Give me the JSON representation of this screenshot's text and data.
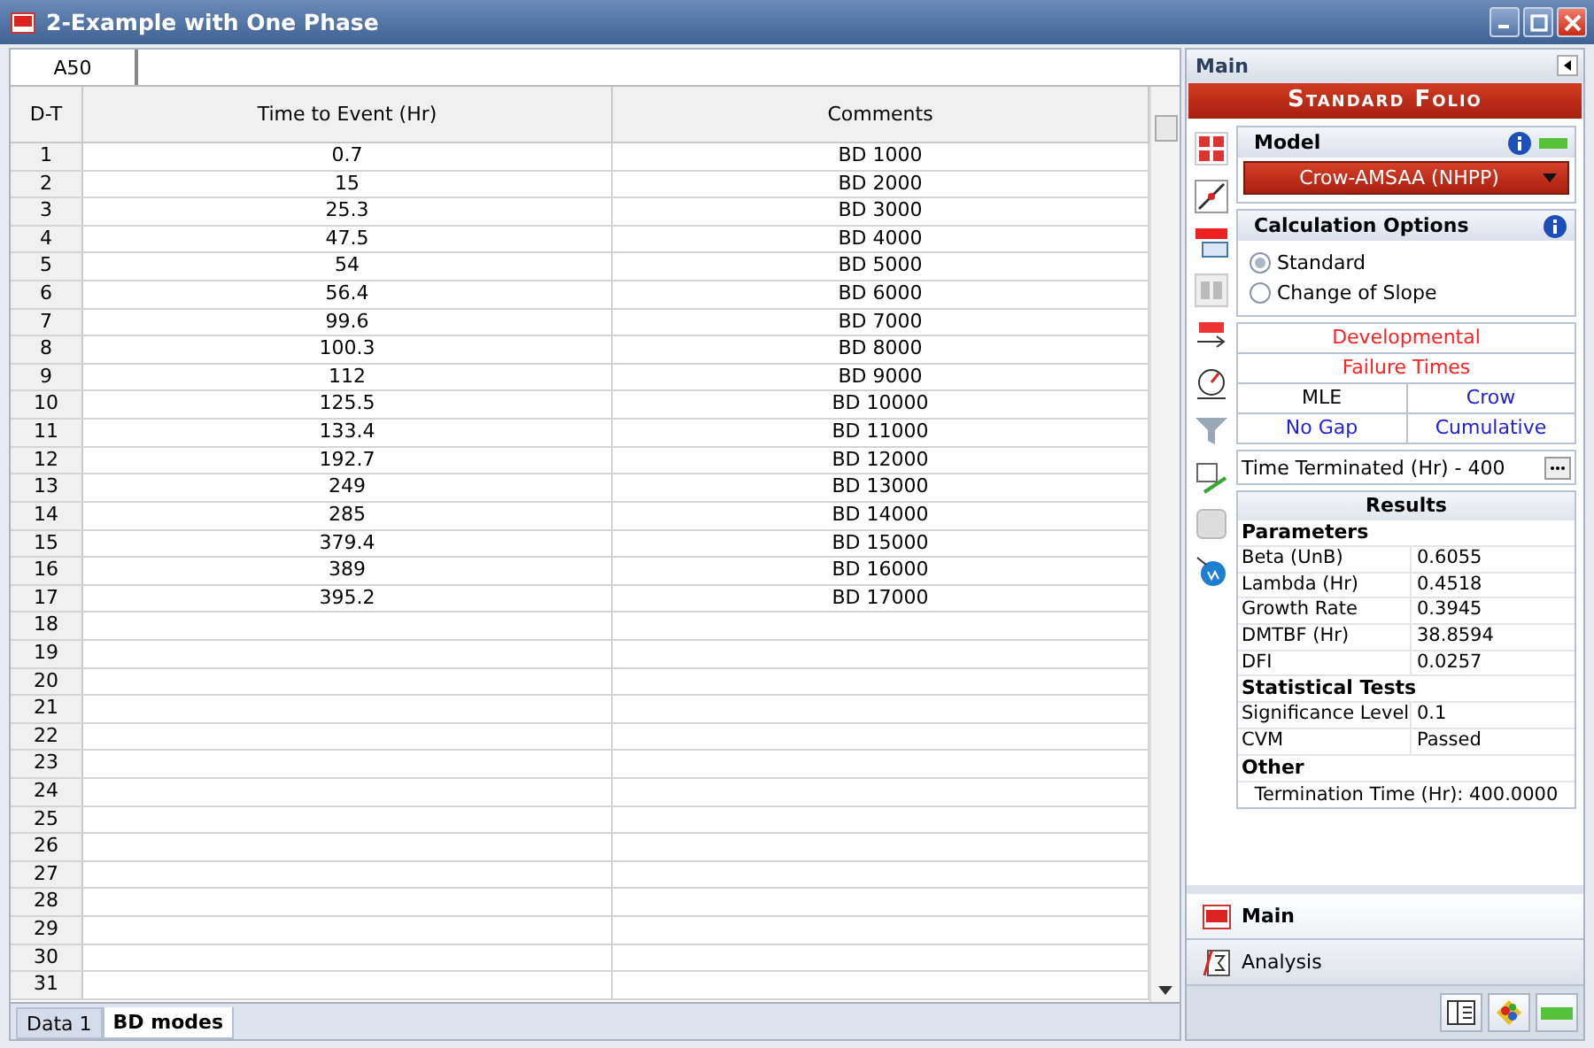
{
  "window": {
    "title": "2-Example with One Phase"
  },
  "cell_reference": "A50",
  "table": {
    "columns": [
      "D-T",
      "Time to Event (Hr)",
      "Comments"
    ],
    "rows": [
      {
        "dt": "1",
        "time": "0.7",
        "comments": "BD 1000"
      },
      {
        "dt": "2",
        "time": "15",
        "comments": "BD 2000"
      },
      {
        "dt": "3",
        "time": "25.3",
        "comments": "BD 3000"
      },
      {
        "dt": "4",
        "time": "47.5",
        "comments": "BD 4000"
      },
      {
        "dt": "5",
        "time": "54",
        "comments": "BD 5000"
      },
      {
        "dt": "6",
        "time": "56.4",
        "comments": "BD 6000"
      },
      {
        "dt": "7",
        "time": "99.6",
        "comments": "BD 7000"
      },
      {
        "dt": "8",
        "time": "100.3",
        "comments": "BD 8000"
      },
      {
        "dt": "9",
        "time": "112",
        "comments": "BD 9000"
      },
      {
        "dt": "10",
        "time": "125.5",
        "comments": "BD 10000"
      },
      {
        "dt": "11",
        "time": "133.4",
        "comments": "BD 11000"
      },
      {
        "dt": "12",
        "time": "192.7",
        "comments": "BD 12000"
      },
      {
        "dt": "13",
        "time": "249",
        "comments": "BD 13000"
      },
      {
        "dt": "14",
        "time": "285",
        "comments": "BD 14000"
      },
      {
        "dt": "15",
        "time": "379.4",
        "comments": "BD 15000"
      },
      {
        "dt": "16",
        "time": "389",
        "comments": "BD 16000"
      },
      {
        "dt": "17",
        "time": "395.2",
        "comments": "BD 17000"
      },
      {
        "dt": "18"
      },
      {
        "dt": "19"
      },
      {
        "dt": "20"
      },
      {
        "dt": "21"
      },
      {
        "dt": "22"
      },
      {
        "dt": "23"
      },
      {
        "dt": "24"
      },
      {
        "dt": "25"
      },
      {
        "dt": "26"
      },
      {
        "dt": "27"
      },
      {
        "dt": "28"
      },
      {
        "dt": "29"
      },
      {
        "dt": "30"
      },
      {
        "dt": "31"
      }
    ]
  },
  "sheet_tabs": [
    {
      "label": "Data 1",
      "selected": false
    },
    {
      "label": "BD modes",
      "selected": true
    }
  ],
  "panel": {
    "header": "Main",
    "banner": "Standard Folio",
    "model": {
      "title": "Model",
      "value": "Crow-AMSAA (NHPP)"
    },
    "calculation_options": {
      "title": "Calculation Options",
      "options": [
        {
          "label": "Standard",
          "selected": true
        },
        {
          "label": "Change of Slope",
          "selected": false
        }
      ]
    },
    "settings": [
      [
        {
          "label": "Developmental",
          "color": "#ff2222"
        }
      ],
      [
        {
          "label": "Failure Times",
          "color": "#ff2222"
        }
      ],
      [
        {
          "label": "MLE",
          "color": "#000000"
        },
        {
          "label": "Crow",
          "color": "#2222dd"
        }
      ],
      [
        {
          "label": "No Gap",
          "color": "#2222dd"
        },
        {
          "label": "Cumulative",
          "color": "#2222dd"
        }
      ]
    ],
    "termination": "Time Terminated (Hr) - 400",
    "results": {
      "title": "Results",
      "sections": [
        {
          "heading": "Parameters",
          "rows": [
            [
              "Beta (UnB)",
              "0.6055"
            ],
            [
              "Lambda (Hr)",
              "0.4518"
            ],
            [
              "Growth Rate",
              "0.3945"
            ],
            [
              "DMTBF (Hr)",
              "38.8594"
            ],
            [
              "DFI",
              "0.0257"
            ]
          ]
        },
        {
          "heading": "Statistical Tests",
          "rows": [
            [
              "Significance Level",
              "0.1"
            ],
            [
              "CVM",
              "Passed"
            ]
          ]
        },
        {
          "heading": "Other",
          "note": "Termination Time (Hr): 400.0000"
        }
      ]
    },
    "nav": [
      {
        "label": "Main",
        "selected": true
      },
      {
        "label": "Analysis",
        "selected": false
      }
    ]
  }
}
